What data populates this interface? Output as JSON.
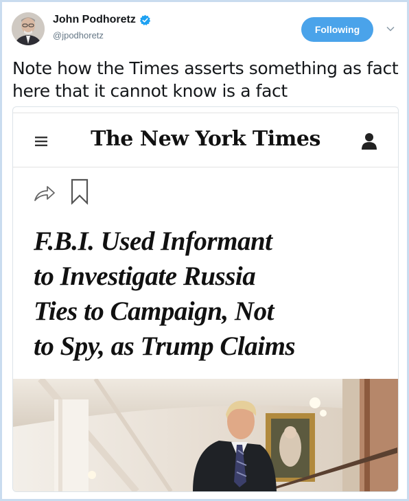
{
  "tweet": {
    "author_name": "John Podhoretz",
    "handle": "@jpodhoretz",
    "follow_button": "Following",
    "text": "Note how the Times asserts something as fact here that it cannot know is a fact"
  },
  "embedded": {
    "masthead": "The New York Times",
    "headline_lines": [
      "F.B.I. Used Informant",
      "to Investigate Russia",
      "Ties to Campaign, Not",
      "to Spy, as Trump Claims"
    ]
  },
  "colors": {
    "follow_button": "#4aa3ea",
    "frame_border": "#c9dcef",
    "verified_badge": "#1da1f2"
  },
  "icons": [
    "verified-icon",
    "chevron-down-icon",
    "hamburger-menu-icon",
    "user-icon",
    "share-icon",
    "bookmark-icon"
  ]
}
